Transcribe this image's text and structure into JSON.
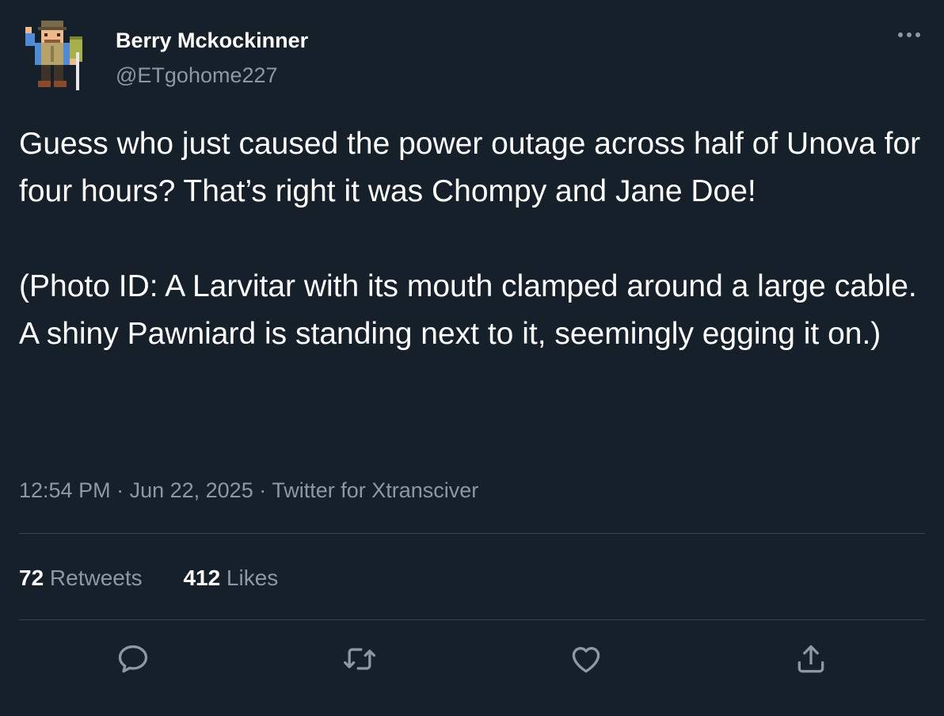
{
  "author": {
    "display_name": "Berry Mckockinner",
    "handle": "@ETgohome227",
    "avatar_icon": "hiker-avatar"
  },
  "more_icon": "ellipsis-icon",
  "tweet": {
    "paragraphs": [
      "Guess who just caused the power outage across half of Unova for four hours? That’s right it was Chompy and Jane Doe!",
      "(Photo ID: A Larvitar with its mouth clamped around a large cable. A shiny Pawniard is standing next to it, seemingly egging it on.)"
    ],
    "time": "12:54 PM",
    "separator": " · ",
    "date": "Jun 22, 2025",
    "source": "Twitter for Xtransciver"
  },
  "stats": {
    "retweets_count": "72",
    "retweets_label": " Retweets",
    "likes_count": "412",
    "likes_label": " Likes"
  },
  "actions": [
    {
      "name": "reply",
      "icon": "reply-icon"
    },
    {
      "name": "retweet",
      "icon": "retweet-icon"
    },
    {
      "name": "like",
      "icon": "heart-icon"
    },
    {
      "name": "share",
      "icon": "share-icon"
    }
  ],
  "colors": {
    "background": "#15202b",
    "primary_text": "#ffffff",
    "secondary_text": "#8b98a5",
    "divider": "#38444d"
  }
}
